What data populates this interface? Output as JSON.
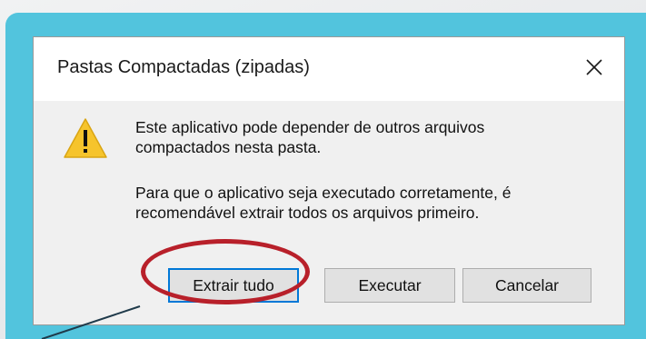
{
  "dialog": {
    "title": "Pastas Compactadas (zipadas)",
    "close_icon": "close-icon",
    "warning_icon": "warning-triangle-icon",
    "message_line1": "Este aplicativo pode depender de outros arquivos",
    "message_line2": "compactados nesta pasta.",
    "message_line3": "Para que o aplicativo seja executado corretamente, é",
    "message_line4": "recomendável extrair todos os arquivos primeiro.",
    "buttons": {
      "extract": "Extrair tudo",
      "run": "Executar",
      "cancel": "Cancelar"
    }
  },
  "colors": {
    "frame": "#52c4dd",
    "highlight": "#b8202a",
    "focus": "#0078d7",
    "warning": "#f6c42c"
  }
}
